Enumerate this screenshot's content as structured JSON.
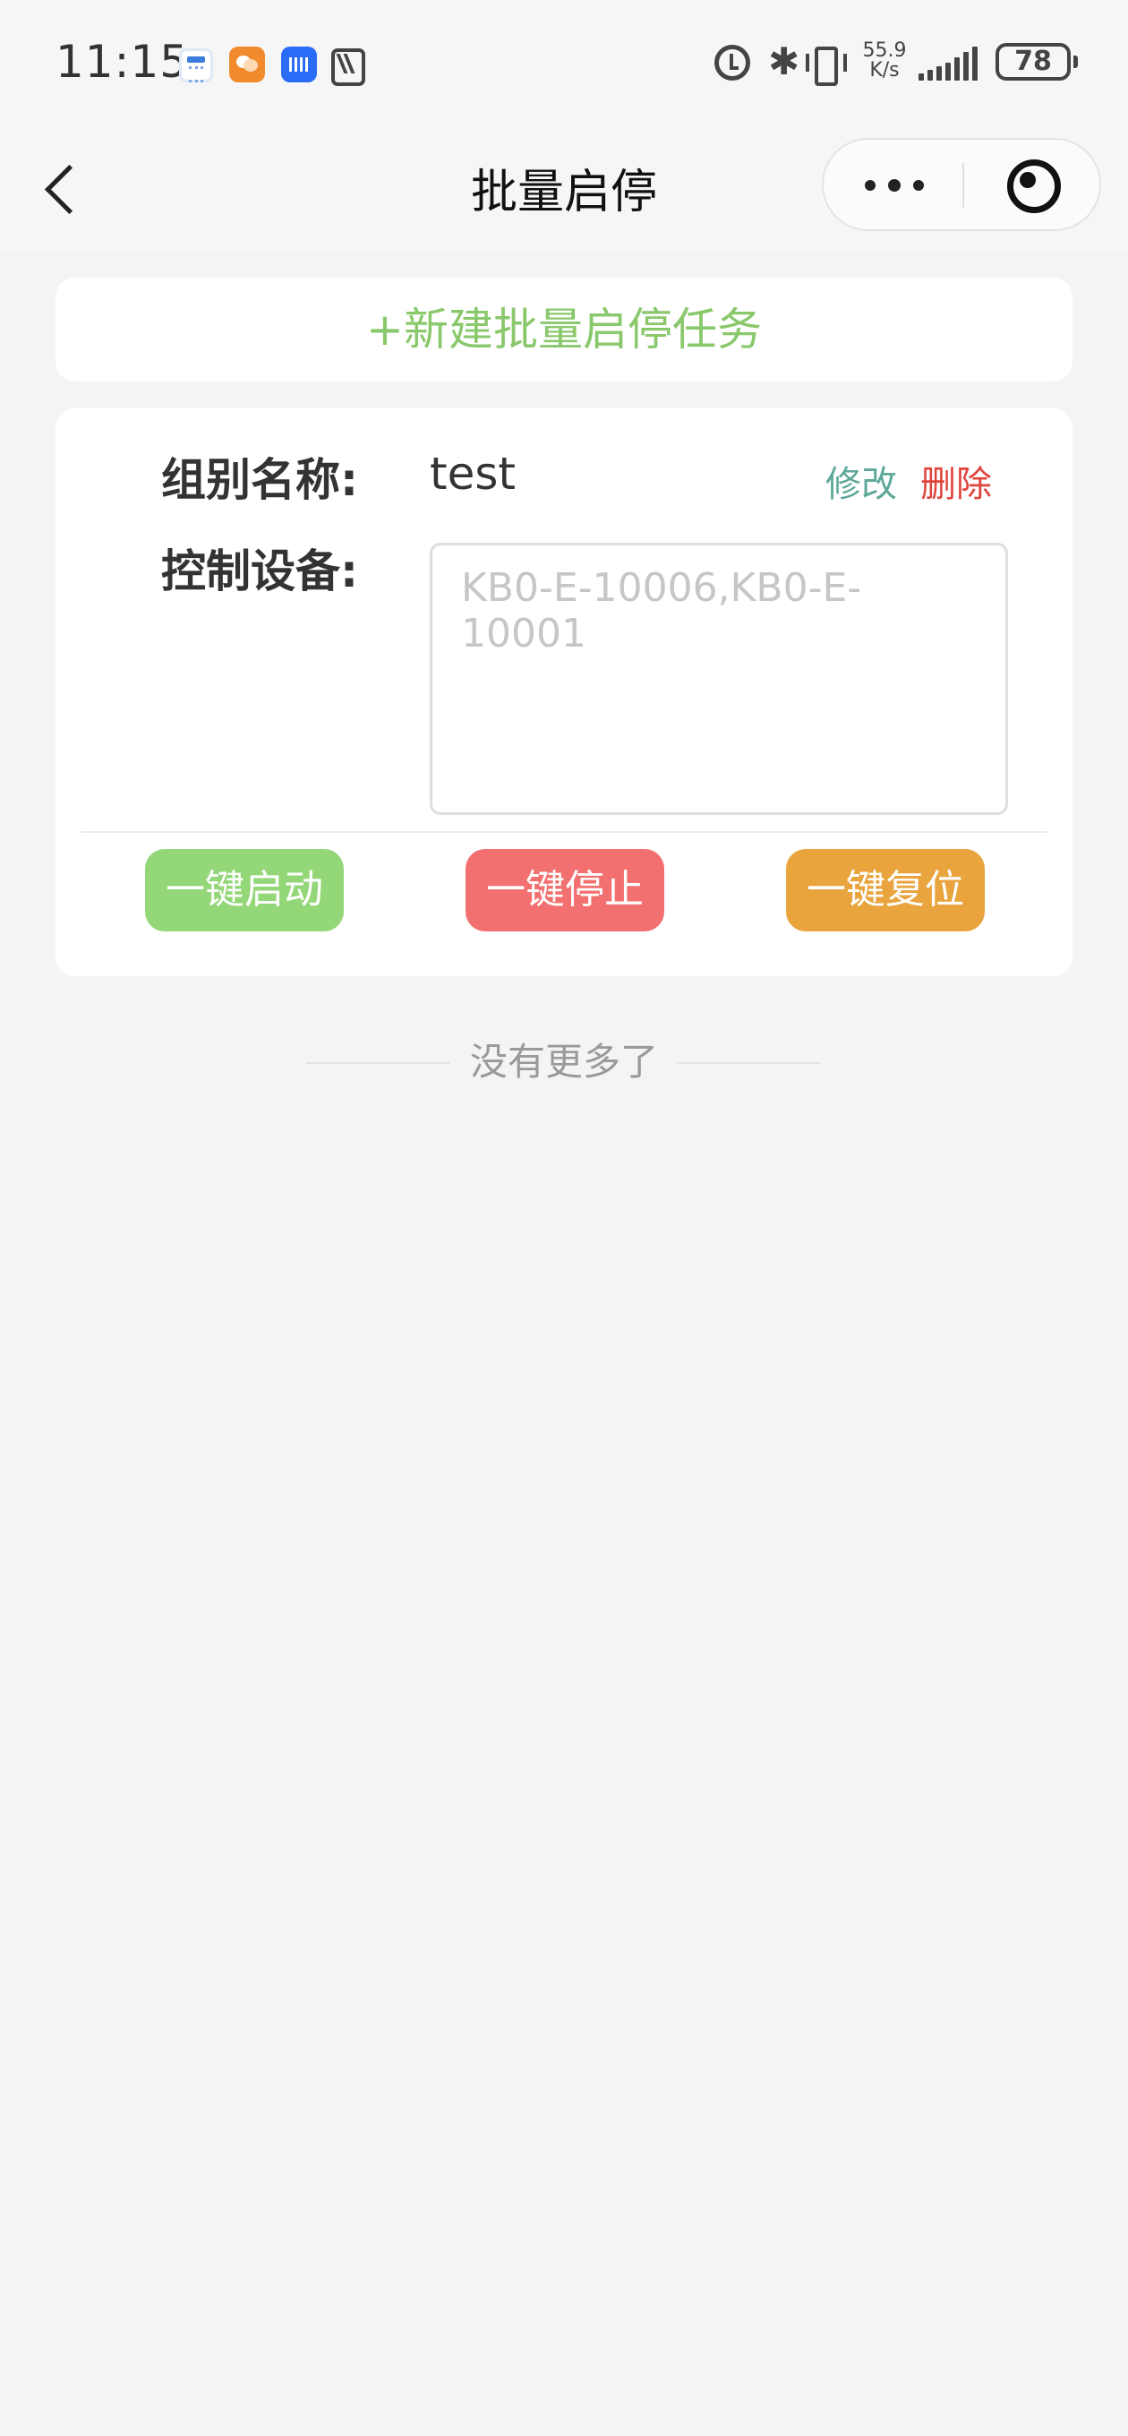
{
  "status_bar": {
    "time": "11:15",
    "net_speed_value": "55.9",
    "net_speed_unit": "K/s",
    "battery": "78"
  },
  "nav": {
    "title": "批量启停"
  },
  "new_task": {
    "label": "+新建批量启停任务"
  },
  "group_card": {
    "name_label": "组别名称:",
    "name_value": "test",
    "edit_label": "修改",
    "delete_label": "删除",
    "devices_label": "控制设备:",
    "devices_placeholder": "KB0-E-10006,KB0-E-10001",
    "actions": {
      "start": "一键启动",
      "stop": "一键停止",
      "reset": "一键复位"
    }
  },
  "footer": {
    "no_more": "没有更多了"
  },
  "colors": {
    "accent_green": "#8ac86c",
    "start_button": "#94d778",
    "stop_button": "#f37070",
    "reset_button": "#e9a43e",
    "edit_text": "#5fa89a",
    "delete_text": "#e0453d"
  }
}
